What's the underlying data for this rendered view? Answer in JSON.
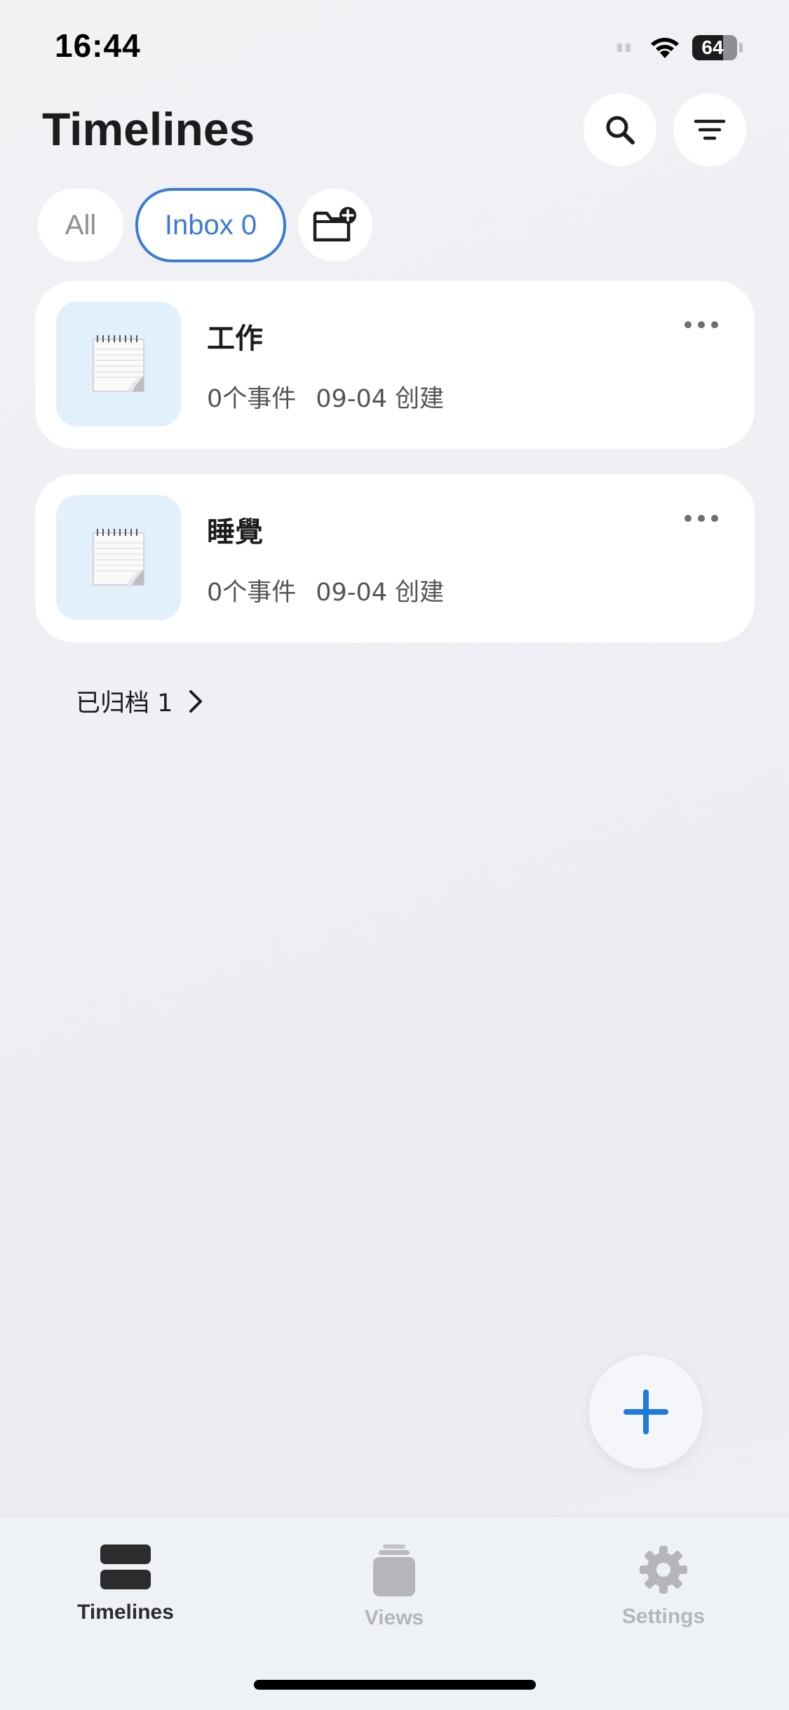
{
  "status_bar": {
    "time": "16:44",
    "battery": "64"
  },
  "header": {
    "title": "Timelines"
  },
  "filters": {
    "all_label": "All",
    "inbox_label": "Inbox 0"
  },
  "timelines": [
    {
      "title": "工作",
      "events": "0个事件",
      "created": "09-04 创建"
    },
    {
      "title": "睡覺",
      "events": "0个事件",
      "created": "09-04 创建"
    }
  ],
  "archived": {
    "label": "已归档 1"
  },
  "tab_bar": {
    "items": [
      {
        "label": "Timelines",
        "icon": "stack-icon",
        "active": true
      },
      {
        "label": "Views",
        "icon": "layers-icon",
        "active": false
      },
      {
        "label": "Settings",
        "icon": "gear-icon",
        "active": false
      }
    ]
  },
  "colors": {
    "accent": "#3a7bd5",
    "fab_plus": "#1f7ae0",
    "thumb_bg": "#e1f0fb",
    "tab_active": "#2c2c2e",
    "tab_inactive": "#b5b5ba"
  }
}
